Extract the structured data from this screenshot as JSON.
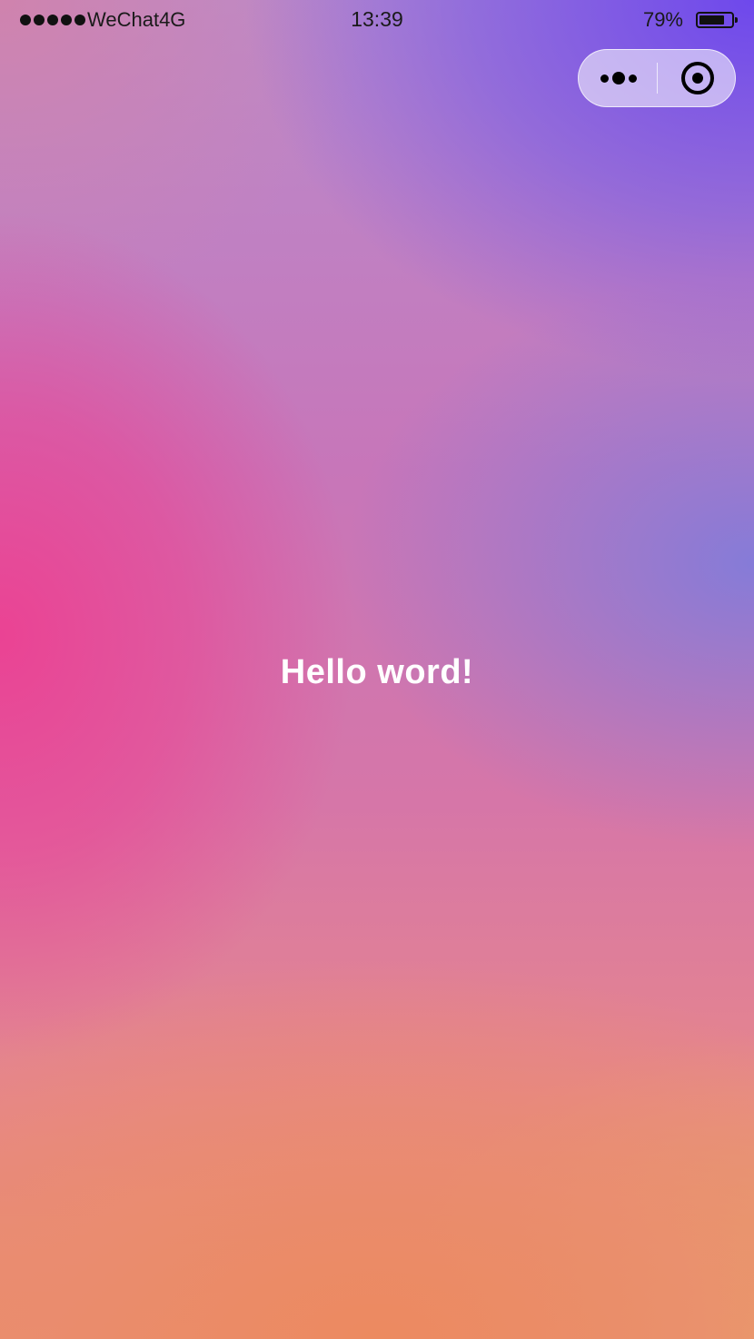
{
  "status_bar": {
    "carrier": "WeChat4G",
    "time": "13:39",
    "battery_percent": "79%",
    "battery_level": 0.79,
    "signal_bars": 5
  },
  "capsule": {
    "more_icon": "more-dots-icon",
    "close_icon": "target-circle-icon"
  },
  "main": {
    "greeting": "Hello word!"
  },
  "colors": {
    "text": "#ffffff",
    "gradient_pink": "#ec4092",
    "gradient_purple": "#6e48ec",
    "gradient_orange": "#ea8c60"
  }
}
